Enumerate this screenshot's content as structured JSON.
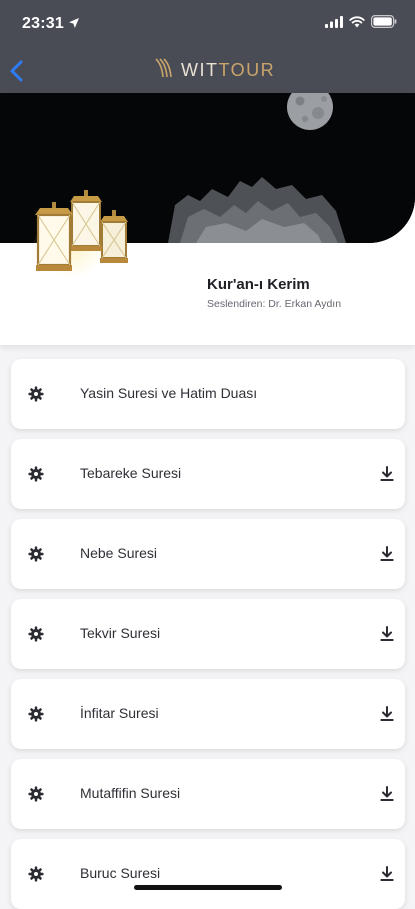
{
  "status_bar": {
    "time": "23:31"
  },
  "header": {
    "logo_part1": "WIT",
    "logo_part2": "TOUR"
  },
  "hero": {
    "title": "Kur'an-ı Kerim",
    "subtitle": "Seslendiren: Dr. Erkan Aydın"
  },
  "list": [
    {
      "label": "Yasin Suresi ve Hatim Duası",
      "downloadable": false
    },
    {
      "label": "Tebareke Suresi",
      "downloadable": true
    },
    {
      "label": "Nebe Suresi",
      "downloadable": true
    },
    {
      "label": "Tekvir Suresi",
      "downloadable": true
    },
    {
      "label": "İnfitar Suresi",
      "downloadable": true
    },
    {
      "label": "Mutaffifin Suresi",
      "downloadable": true
    },
    {
      "label": "Buruc Suresi",
      "downloadable": true
    }
  ],
  "icons": {
    "back": "chevron-left-icon",
    "item_leading": "gear-icon",
    "item_trailing": "download-icon",
    "status": [
      "location-arrow-icon",
      "signal-icon",
      "wifi-icon",
      "battery-icon"
    ]
  },
  "colors": {
    "top_bar": "#4a4c55",
    "accent_blue": "#2f7cf6",
    "logo_gold": "#c9a46b",
    "hero_dark": "#050608",
    "background": "#f4f4f6"
  }
}
